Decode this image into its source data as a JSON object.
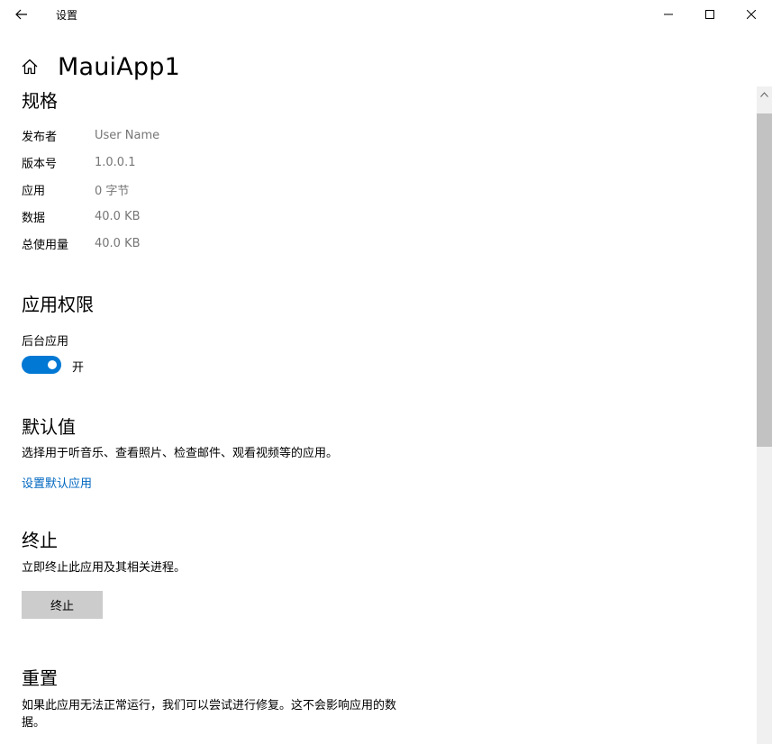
{
  "window": {
    "title": "设置"
  },
  "header": {
    "app_name": "MauiApp1"
  },
  "specs": {
    "title": "规格",
    "rows": [
      {
        "label": "发布者",
        "value": "User Name"
      },
      {
        "label": "版本号",
        "value": "1.0.0.1"
      },
      {
        "label": "应用",
        "value": "0 字节"
      },
      {
        "label": "数据",
        "value": "40.0 KB"
      },
      {
        "label": "总使用量",
        "value": "40.0 KB"
      }
    ]
  },
  "permissions": {
    "title": "应用权限",
    "background_label": "后台应用",
    "toggle_state": "开",
    "toggle_on": true
  },
  "defaults": {
    "title": "默认值",
    "description": "选择用于听音乐、查看照片、检查邮件、观看视频等的应用。",
    "link_label": "设置默认应用"
  },
  "terminate": {
    "title": "终止",
    "description": "立即终止此应用及其相关进程。",
    "button_label": "终止"
  },
  "reset": {
    "title": "重置",
    "description_line1": "如果此应用无法正常运行，我们可以尝试进行修复。这不会影响应用的数",
    "description_line2": "据。"
  },
  "colors": {
    "accent": "#0078d4",
    "link": "#0067c0",
    "muted_text": "#767676",
    "button_bg": "#cccccc"
  }
}
